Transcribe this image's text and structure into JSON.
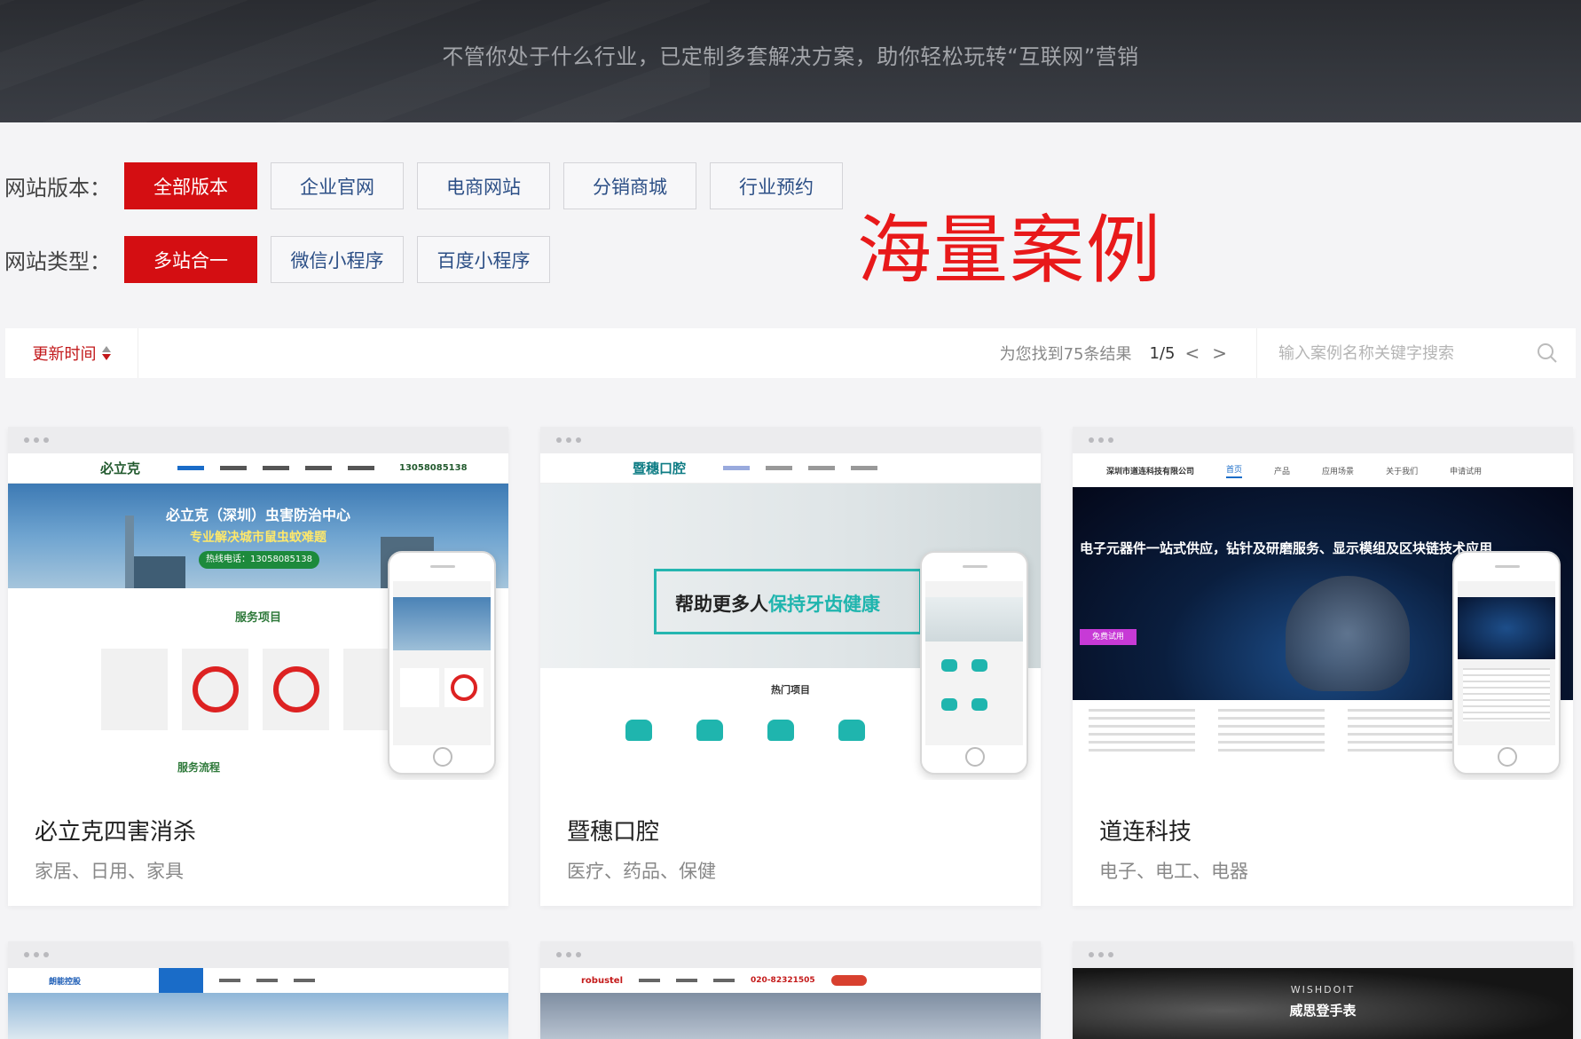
{
  "hero": {
    "subtitle": "不管你处于什么行业，已定制多套解决方案，助你轻松玩转“互联网”营销"
  },
  "filters": {
    "version_label": "网站版本：",
    "version_options": [
      "全部版本",
      "企业官网",
      "电商网站",
      "分销商城",
      "行业预约"
    ],
    "version_selected": "全部版本",
    "type_label": "网站类型：",
    "type_options": [
      "多站合一",
      "微信小程序",
      "百度小程序"
    ],
    "type_selected": "多站合一"
  },
  "big_title": "海量案例",
  "toolbar": {
    "sort_label": "更新时间",
    "result_text": "为您找到75条结果",
    "page": "1/5",
    "prev": "<",
    "next": ">",
    "search_placeholder": "输入案例名称关键字搜索"
  },
  "cards": [
    {
      "title": "必立克四害消杀",
      "tags": "家居、日用、家具",
      "preview": {
        "logo": "必立克",
        "phone": "13058085138",
        "banner_title": "必立克（深圳）虫害防治中心",
        "banner_sub": "专业解决城市鼠虫蚊难题",
        "banner_hotline": "热线电话：13058085138",
        "section1": "服务项目",
        "section2": "服务流程"
      }
    },
    {
      "title": "暨穗口腔",
      "tags": "医疗、药品、保健",
      "preview": {
        "logo": "暨穗口腔",
        "banner_prefix": "帮助更多人",
        "banner_highlight": "保持牙齿健康",
        "section1": "热门项目"
      }
    },
    {
      "title": "道连科技",
      "tags": "电子、电工、电器",
      "preview": {
        "logo": "深圳市道连科技有限公司",
        "nav": [
          "首页",
          "产品",
          "应用场景",
          "关于我们",
          "申请试用"
        ],
        "banner_title": "电子元器件一站式供应，钻针及研磨服务、显示模组及区块链技术应用",
        "button": "免费试用"
      }
    },
    {
      "title": "",
      "tags": "",
      "preview": {
        "logo": "朗能控股"
      }
    },
    {
      "title": "",
      "tags": "",
      "preview": {
        "logo": "robustel",
        "phone": "020-82321505"
      }
    },
    {
      "title": "",
      "tags": "",
      "preview": {
        "logo": "WISHDOIT",
        "banner_title": "威思登手表"
      }
    }
  ],
  "colors": {
    "accent": "#d40e12",
    "chip_text": "#2c4f86",
    "big_title": "#e8191a"
  }
}
